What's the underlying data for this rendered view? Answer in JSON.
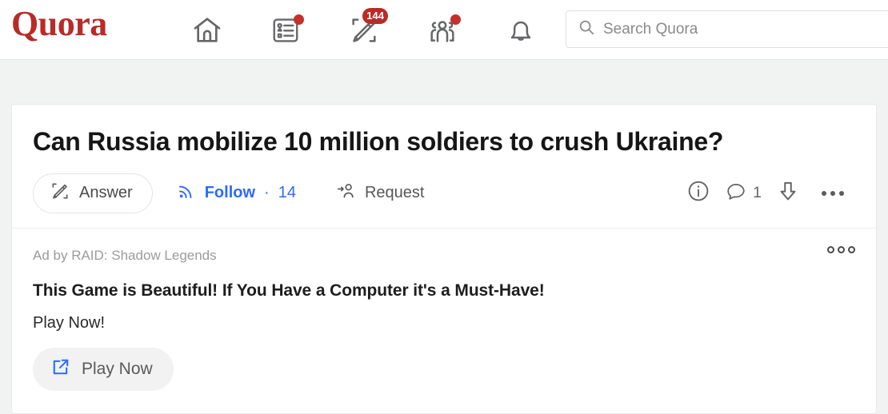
{
  "header": {
    "logo_text": "Quora",
    "logo_color": "#b92b27",
    "nav_items": [
      {
        "name": "home",
        "icon": "home-icon",
        "badge": null,
        "badge_type": "none"
      },
      {
        "name": "answers",
        "icon": "answers-list-icon",
        "badge": "",
        "badge_type": "dot"
      },
      {
        "name": "write",
        "icon": "write-pencil-icon",
        "badge": "144",
        "badge_type": "count"
      },
      {
        "name": "spaces",
        "icon": "spaces-people-icon",
        "badge": "",
        "badge_type": "dot"
      },
      {
        "name": "notifications",
        "icon": "bell-icon",
        "badge": null,
        "badge_type": "none"
      }
    ],
    "search": {
      "icon": "search-icon",
      "placeholder": "Search Quora",
      "value": ""
    },
    "badge_color": "#b92b27"
  },
  "question": {
    "title": "Can Russia mobilize 10 million soldiers to crush Ukraine?",
    "actions": {
      "answer_label": "Answer",
      "answer_icon": "pencil-edit-icon",
      "follow_label": "Follow",
      "follow_separator": "·",
      "follow_count": "14",
      "follow_icon": "rss-follow-icon",
      "follow_color": "#2e69ff",
      "request_label": "Request",
      "request_icon": "request-person-icon"
    },
    "right_actions": {
      "info_icon": "info-circle-icon",
      "comment_icon": "comment-bubble-icon",
      "comment_count": "1",
      "downvote_icon": "downvote-arrow-icon",
      "more_icon": "more-horizontal-icon"
    }
  },
  "ad": {
    "label": "Ad by RAID: Shadow Legends",
    "menu_icon": "ad-options-icon",
    "headline": "This Game is Beautiful! If You Have a Computer it's a Must-Have!",
    "body": "Play Now!",
    "cta_label": "Play Now",
    "cta_icon": "external-link-icon",
    "cta_icon_color": "#2e69ff"
  }
}
